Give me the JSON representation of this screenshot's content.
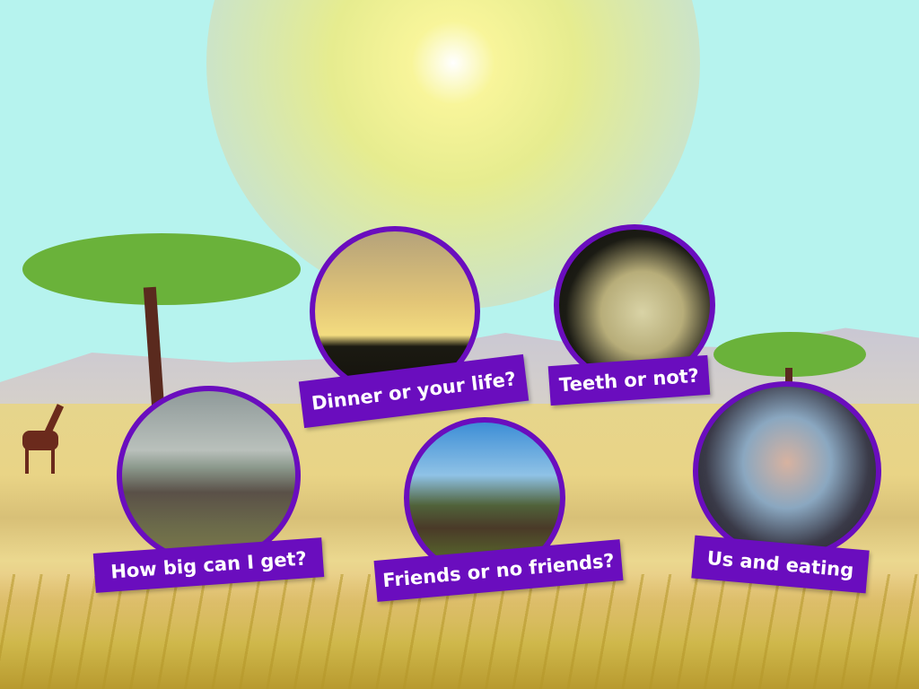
{
  "colors": {
    "sky": "#b6f3ee",
    "accent": "#6a0dbe",
    "label_text": "#ffffff"
  },
  "topics": [
    {
      "label": "Dinner or your life?",
      "image": "gazelle-cheetah-chase"
    },
    {
      "label": "Teeth or not?",
      "image": "animal-skull"
    },
    {
      "label": "How big can I get?",
      "image": "elephant-herd"
    },
    {
      "label": "Friends or no friends?",
      "image": "moose"
    },
    {
      "label": "Us and eating",
      "image": "people-campfire"
    }
  ]
}
